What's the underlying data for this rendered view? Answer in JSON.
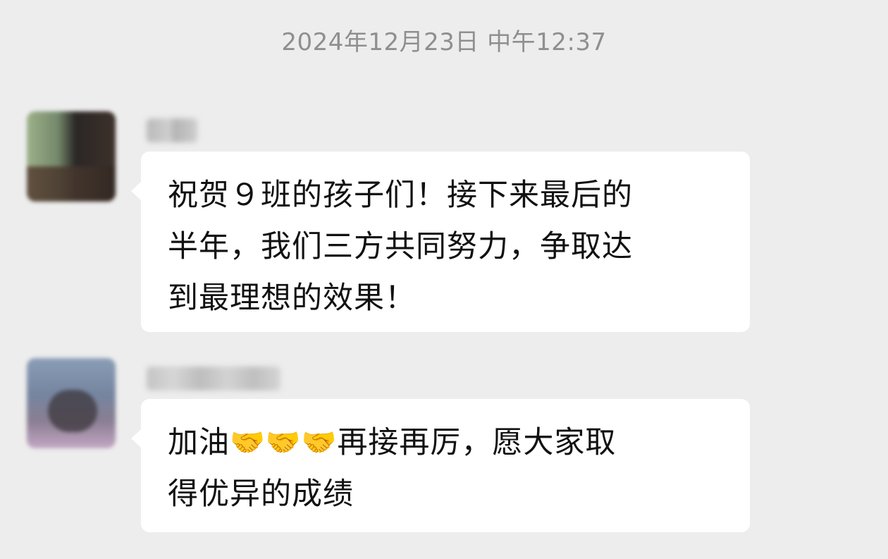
{
  "chat": {
    "timestamp": "2024年12月23日 中午12:37",
    "messages": [
      {
        "sender": "",
        "lines": [
          "祝贺９班的孩子们！接下来最后的",
          "半年，我们三方共同努力，争取达",
          "到最理想的效果！"
        ]
      },
      {
        "sender": "",
        "line1_prefix": "加油",
        "emojis": [
          "🤝",
          "🤝",
          "🤝"
        ],
        "line1_suffix": "再接再厉，愿大家取",
        "line2": "得优异的成绩"
      }
    ]
  }
}
